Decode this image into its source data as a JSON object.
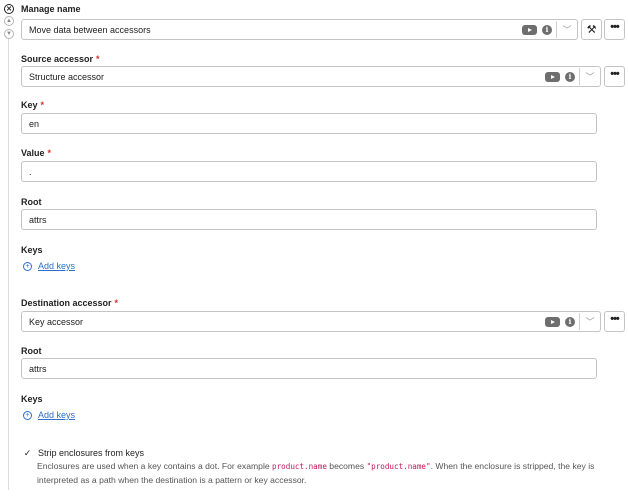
{
  "gutter": {
    "close_glyph": "✕",
    "up_glyph": "▲",
    "down_glyph": "▼"
  },
  "manage": {
    "label": "Manage name",
    "value": "Move data between accessors"
  },
  "source": {
    "label": "Source accessor",
    "required": "*",
    "value": "Structure accessor"
  },
  "key": {
    "label": "Key",
    "required": "*",
    "value": "en"
  },
  "value_field": {
    "label": "Value",
    "required": "*",
    "value": "."
  },
  "source_root": {
    "label": "Root",
    "value": "attrs"
  },
  "source_keys": {
    "label": "Keys",
    "add_label": "Add keys"
  },
  "destination": {
    "label": "Destination accessor",
    "required": "*",
    "value": "Key accessor"
  },
  "dest_root": {
    "label": "Root",
    "value": "attrs"
  },
  "dest_keys": {
    "label": "Keys",
    "add_label": "Add keys"
  },
  "strip": {
    "checked": true,
    "label": "Strip enclosures from keys",
    "help_part1": "Enclosures are used when a key contains a dot. For example ",
    "code1": "product.name",
    "help_part2": " becomes ",
    "code2": "\"product.name\"",
    "help_part3": ". When the enclosure is stripped, the key is interpreted as a path when the destination is a pattern or key accessor."
  },
  "icons": {
    "video": "youtube-icon",
    "info": "info-icon",
    "chevron": "chevron-down-icon",
    "more": "more-dots-icon",
    "tools": "tools-icon"
  },
  "colors": {
    "link": "#2d6fcf",
    "required": "#d32f2f",
    "code": "#c2185b",
    "border": "#c4c4c4",
    "icon": "#6e6e6e"
  }
}
